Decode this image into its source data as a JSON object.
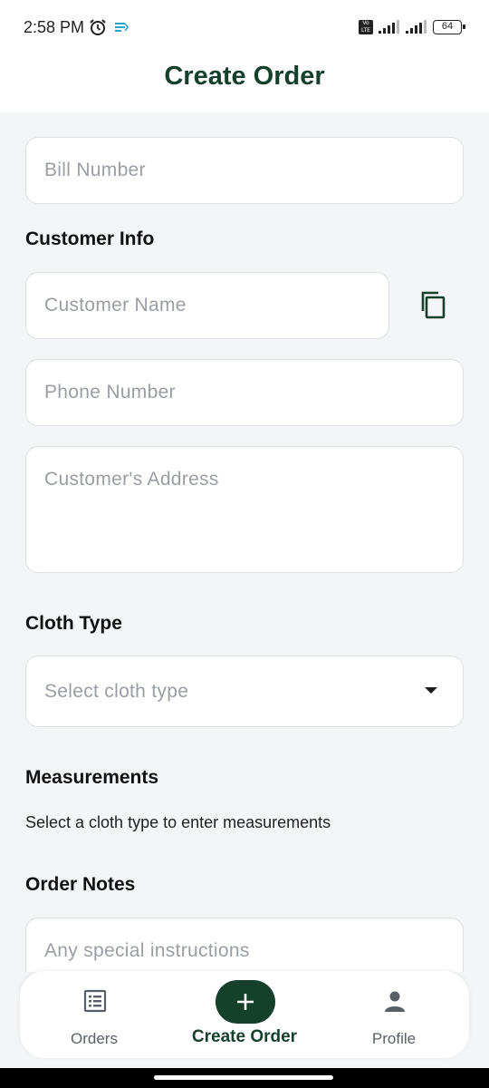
{
  "status_bar": {
    "time": "2:58 PM",
    "battery": "64"
  },
  "header": {
    "title": "Create Order"
  },
  "form": {
    "bill_number_placeholder": "Bill Number",
    "customer_info_label": "Customer Info",
    "customer_name_placeholder": "Customer Name",
    "phone_placeholder": "Phone Number",
    "address_placeholder": "Customer's Address",
    "cloth_type_label": "Cloth Type",
    "cloth_type_placeholder": "Select cloth type",
    "measurements_label": "Measurements",
    "measurements_hint": "Select a cloth type to enter measurements",
    "order_notes_label": "Order Notes",
    "order_notes_placeholder": "Any special instructions"
  },
  "bottom_nav": {
    "items": [
      {
        "label": "Orders",
        "icon": "list-icon"
      },
      {
        "label": "Create Order",
        "icon": "plus-icon",
        "active": true
      },
      {
        "label": "Profile",
        "icon": "person-icon"
      }
    ]
  },
  "colors": {
    "brand": "#14402c",
    "background": "#f4f5f7",
    "placeholder": "#9a9ea4"
  }
}
